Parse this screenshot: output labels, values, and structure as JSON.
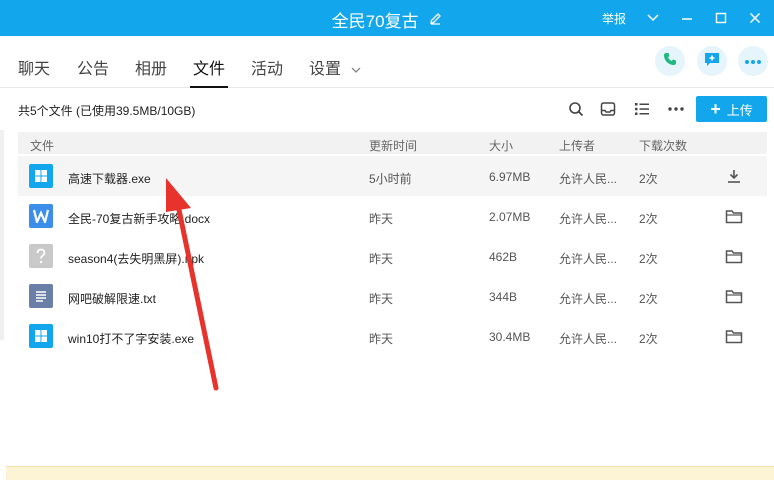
{
  "window": {
    "title": "全民70复古",
    "report_label": "举报",
    "accent_color": "#12a7ec"
  },
  "tabs": [
    {
      "label": "聊天"
    },
    {
      "label": "公告"
    },
    {
      "label": "相册"
    },
    {
      "label": "文件",
      "active": true
    },
    {
      "label": "活动"
    },
    {
      "label": "设置"
    }
  ],
  "toolbar": {
    "summary": "共5个文件 (已使用39.5MB/10GB)",
    "upload_label": "上传"
  },
  "table": {
    "headers": {
      "name": "文件",
      "time": "更新时间",
      "size": "大小",
      "uploader": "上传者",
      "downloads": "下载次数"
    },
    "rows": [
      {
        "name": "高速下载器.exe",
        "time": "5小时前",
        "size": "6.97MB",
        "uploader": "允许人民...",
        "downloads": "2次",
        "icon": "windows-file-icon",
        "action": "download-icon"
      },
      {
        "name": "全民-70复古新手攻略.docx",
        "time": "昨天",
        "size": "2.07MB",
        "uploader": "允许人民...",
        "downloads": "2次",
        "icon": "word-file-icon",
        "action": "folder-icon"
      },
      {
        "name": "season4(去失明黑屏).npk",
        "time": "昨天",
        "size": "462B",
        "uploader": "允许人民...",
        "downloads": "2次",
        "icon": "unknown-file-icon",
        "action": "folder-icon"
      },
      {
        "name": "网吧破解限速.txt",
        "time": "昨天",
        "size": "344B",
        "uploader": "允许人民...",
        "downloads": "2次",
        "icon": "text-file-icon",
        "action": "folder-icon"
      },
      {
        "name": "win10打不了字安装.exe",
        "time": "昨天",
        "size": "30.4MB",
        "uploader": "允许人民...",
        "downloads": "2次",
        "icon": "windows-file-icon",
        "action": "folder-icon"
      }
    ]
  }
}
